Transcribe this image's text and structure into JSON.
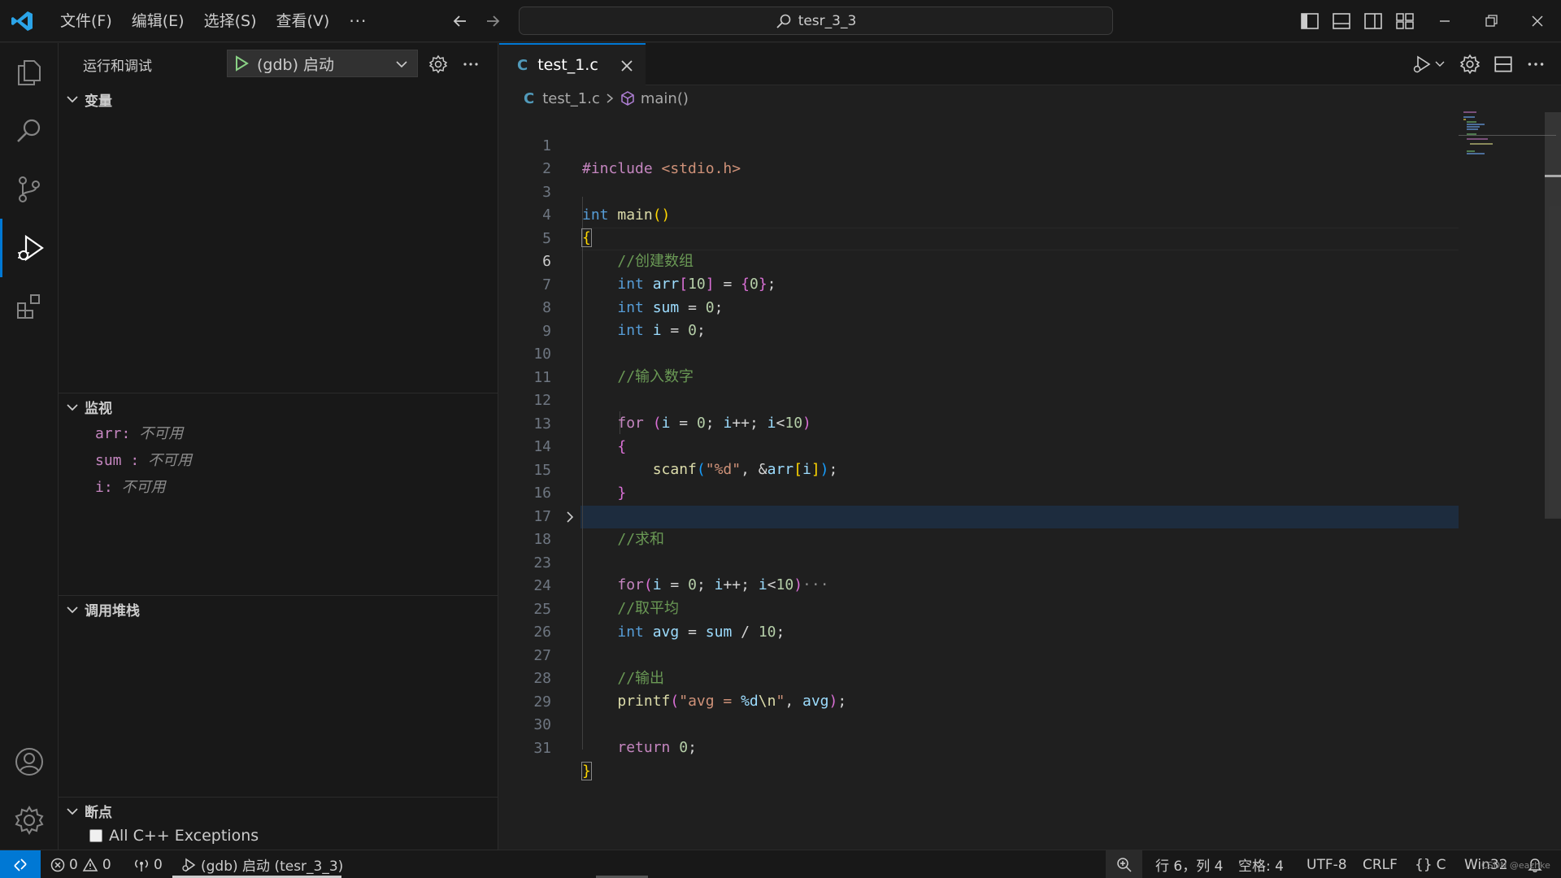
{
  "titlebar": {
    "menu": [
      "文件(F)",
      "编辑(E)",
      "选择(S)",
      "查看(V)"
    ],
    "more": "···",
    "search_text": "tesr_3_3"
  },
  "sidebar": {
    "title": "运行和调试",
    "config_label": "(gdb) 启动",
    "sections": {
      "variables": "变量",
      "watch": "监视",
      "callstack": "调用堆栈",
      "breakpoints": "断点"
    },
    "watch_items": [
      {
        "name": "arr:",
        "value": "不可用"
      },
      {
        "name": "sum :",
        "value": "不可用"
      },
      {
        "name": "i:",
        "value": "不可用"
      }
    ],
    "breakpoint_items": [
      {
        "label": "All C++ Exceptions"
      }
    ]
  },
  "editor": {
    "tab": {
      "lang": "C",
      "name": "test_1.c"
    },
    "breadcrumb": {
      "lang": "C",
      "file": "test_1.c",
      "symbol": "main()"
    },
    "line_numbers": [
      "1",
      "2",
      "3",
      "4",
      "5",
      "6",
      "7",
      "8",
      "9",
      "10",
      "11",
      "12",
      "13",
      "14",
      "15",
      "16",
      "17",
      "18",
      "23",
      "24",
      "25",
      "26",
      "27",
      "28",
      "29",
      "30",
      "31"
    ],
    "current_line": "6",
    "folded_line": "18"
  },
  "statusbar": {
    "errors": "0",
    "warnings": "0",
    "ports": "0",
    "debug": "(gdb) 启动 (tesr_3_3)",
    "position": "行 6，列 4",
    "spaces": "空格: 4",
    "encoding": "UTF-8",
    "eol": "CRLF",
    "language": "C",
    "platform": "Win32",
    "watermark": "CSDN @eazhke"
  },
  "colors": {
    "accent": "#0078d4",
    "background": "#1f1f1f",
    "sidebar": "#181818"
  }
}
